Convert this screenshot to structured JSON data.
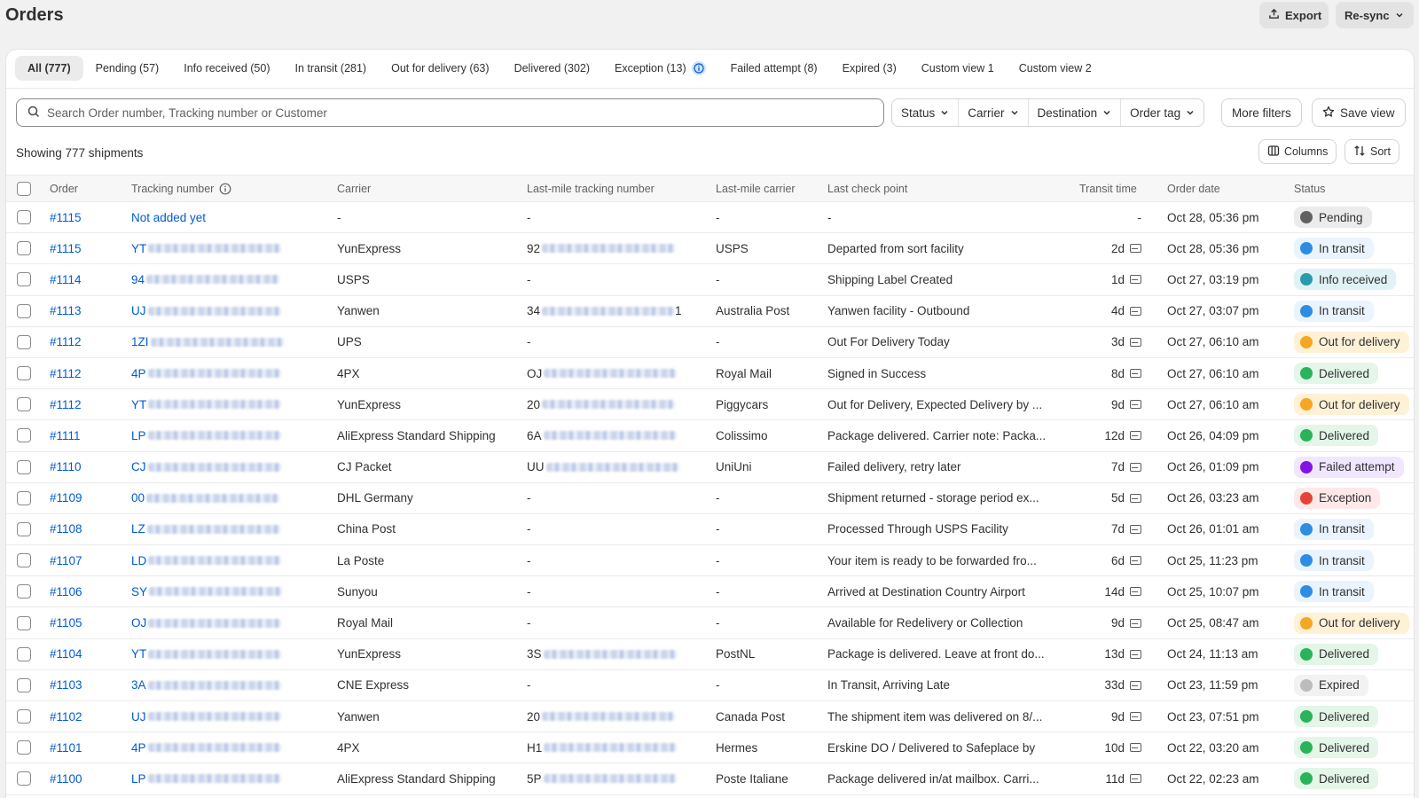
{
  "page": {
    "title": "Orders"
  },
  "actions": {
    "export": "Export",
    "resync": "Re-sync"
  },
  "tabs": [
    {
      "label": "All (777)",
      "active": true
    },
    {
      "label": "Pending (57)"
    },
    {
      "label": "Info received (50)"
    },
    {
      "label": "In transit (281)"
    },
    {
      "label": "Out for delivery (63)"
    },
    {
      "label": "Delivered (302)"
    },
    {
      "label": "Exception (13)",
      "info": true
    },
    {
      "label": "Failed attempt (8)"
    },
    {
      "label": "Expired (3)"
    },
    {
      "label": "Custom view 1"
    },
    {
      "label": "Custom view 2"
    }
  ],
  "search": {
    "placeholder": "Search Order number, Tracking number or Customer"
  },
  "filters": [
    "Status",
    "Carrier",
    "Destination",
    "Order tag"
  ],
  "more_filters": "More filters",
  "save_view": "Save view",
  "showing": "Showing 777 shipments",
  "columns_btn": "Columns",
  "sort_btn": "Sort",
  "columns": {
    "order": "Order",
    "tracking": "Tracking number",
    "carrier": "Carrier",
    "lm_tracking": "Last-mile tracking number",
    "lm_carrier": "Last-mile carrier",
    "checkpoint": "Last check point",
    "transit": "Transit time",
    "date": "Order date",
    "status": "Status"
  },
  "status_colors": {
    "Pending": {
      "bg": "#ebebeb",
      "dot": "#616161"
    },
    "In transit": {
      "bg": "#eaf4ff",
      "dot": "#2c8de3"
    },
    "Info received": {
      "bg": "#e0f2f5",
      "dot": "#2a9aae"
    },
    "Out for delivery": {
      "bg": "#fff1d6",
      "dot": "#f5a623"
    },
    "Delivered": {
      "bg": "#e3f6e8",
      "dot": "#29b35a"
    },
    "Failed attempt": {
      "bg": "#f1e6ff",
      "dot": "#8314e3"
    },
    "Exception": {
      "bg": "#fee9e8",
      "dot": "#e5433a"
    },
    "Expired": {
      "bg": "#f2f2f2",
      "dot": "#bcbcbc"
    }
  },
  "rows": [
    {
      "order": "#1115",
      "tracking": "Not added yet",
      "blur": false,
      "carrier": "-",
      "lm_tracking": "-",
      "lm_blur": false,
      "lm_carrier": "-",
      "checkpoint": "-",
      "transit": "-",
      "mail": false,
      "date": "Oct 28, 05:36 pm",
      "status": "Pending"
    },
    {
      "order": "#1115",
      "tracking": "YT",
      "blur": true,
      "carrier": "YunExpress",
      "lm_tracking": "92",
      "lm_blur": true,
      "lm_carrier": "USPS",
      "checkpoint": "Departed from sort facility",
      "transit": "2d",
      "mail": true,
      "date": "Oct 28, 05:36 pm",
      "status": "In transit"
    },
    {
      "order": "#1114",
      "tracking": "94",
      "blur": true,
      "carrier": "USPS",
      "lm_tracking": "-",
      "lm_blur": false,
      "lm_carrier": "-",
      "checkpoint": "Shipping Label Created",
      "transit": "1d",
      "mail": true,
      "date": "Oct 27, 03:19 pm",
      "status": "Info received"
    },
    {
      "order": "#1113",
      "tracking": "UJ",
      "blur": true,
      "carrier": "Yanwen",
      "lm_tracking": "34",
      "lm_blur": true,
      "lm_tail": "1",
      "lm_carrier": "Australia Post",
      "checkpoint": "Yanwen facility - Outbound",
      "transit": "4d",
      "mail": true,
      "date": "Oct 27, 03:07 pm",
      "status": "In transit"
    },
    {
      "order": "#1112",
      "tracking": "1ZI",
      "blur": true,
      "carrier": "UPS",
      "lm_tracking": "-",
      "lm_blur": false,
      "lm_carrier": "-",
      "checkpoint": "Out For Delivery Today",
      "transit": "3d",
      "mail": true,
      "date": "Oct 27, 06:10 am",
      "status": "Out for delivery"
    },
    {
      "order": "#1112",
      "tracking": "4P",
      "blur": true,
      "carrier": "4PX",
      "lm_tracking": "OJ",
      "lm_blur": true,
      "lm_carrier": "Royal Mail",
      "checkpoint": "Signed in Success",
      "transit": "8d",
      "mail": true,
      "date": "Oct 27, 06:10 am",
      "status": "Delivered"
    },
    {
      "order": "#1112",
      "tracking": "YT",
      "blur": true,
      "carrier": "YunExpress",
      "lm_tracking": "20",
      "lm_blur": true,
      "lm_carrier": "Piggycars",
      "checkpoint": "Out for Delivery, Expected Delivery by ...",
      "transit": "9d",
      "mail": true,
      "date": "Oct 27, 06:10 am",
      "status": "Out for delivery"
    },
    {
      "order": "#1111",
      "tracking": "LP",
      "blur": true,
      "carrier": "AliExpress Standard Shipping",
      "lm_tracking": "6A",
      "lm_blur": true,
      "lm_carrier": "Colissimo",
      "checkpoint": "Package delivered. Carrier note: Packa...",
      "transit": "12d",
      "mail": true,
      "date": "Oct 26, 04:09 pm",
      "status": "Delivered"
    },
    {
      "order": "#1110",
      "tracking": "CJ",
      "blur": true,
      "carrier": "CJ Packet",
      "lm_tracking": "UU",
      "lm_blur": true,
      "lm_carrier": "UniUni",
      "checkpoint": "Failed delivery, retry later",
      "transit": "7d",
      "mail": true,
      "date": "Oct 26, 01:09 pm",
      "status": "Failed attempt"
    },
    {
      "order": "#1109",
      "tracking": "00",
      "blur": true,
      "carrier": "DHL Germany",
      "lm_tracking": "-",
      "lm_blur": false,
      "lm_carrier": "-",
      "checkpoint": "Shipment returned - storage period ex...",
      "transit": "5d",
      "mail": true,
      "date": "Oct 26, 03:23 am",
      "status": "Exception"
    },
    {
      "order": "#1108",
      "tracking": "LZ",
      "blur": true,
      "carrier": "China Post",
      "lm_tracking": "-",
      "lm_blur": false,
      "lm_carrier": "-",
      "checkpoint": "Processed Through USPS Facility",
      "transit": "7d",
      "mail": true,
      "date": "Oct 26, 01:01 am",
      "status": "In transit"
    },
    {
      "order": "#1107",
      "tracking": "LD",
      "blur": true,
      "carrier": "La Poste",
      "lm_tracking": "-",
      "lm_blur": false,
      "lm_carrier": "-",
      "checkpoint": "Your item is ready to be forwarded fro...",
      "transit": "6d",
      "mail": true,
      "date": "Oct 25, 11:23 pm",
      "status": "In transit"
    },
    {
      "order": "#1106",
      "tracking": "SY",
      "blur": true,
      "carrier": "Sunyou",
      "lm_tracking": "-",
      "lm_blur": false,
      "lm_carrier": "-",
      "checkpoint": "Arrived at Destination Country Airport",
      "transit": "14d",
      "mail": true,
      "date": "Oct 25, 10:07 pm",
      "status": "In transit"
    },
    {
      "order": "#1105",
      "tracking": "OJ",
      "blur": true,
      "carrier": "Royal Mail",
      "lm_tracking": "-",
      "lm_blur": false,
      "lm_carrier": "-",
      "checkpoint": "Available for Redelivery or Collection",
      "transit": "9d",
      "mail": true,
      "date": "Oct 25, 08:47 am",
      "status": "Out for delivery"
    },
    {
      "order": "#1104",
      "tracking": "YT",
      "blur": true,
      "carrier": "YunExpress",
      "lm_tracking": "3S",
      "lm_blur": true,
      "lm_carrier": "PostNL",
      "checkpoint": "Package is delivered. Leave at front do...",
      "transit": "13d",
      "mail": true,
      "date": "Oct 24, 11:13 am",
      "status": "Delivered"
    },
    {
      "order": "#1103",
      "tracking": "3A",
      "blur": true,
      "carrier": "CNE Express",
      "lm_tracking": "-",
      "lm_blur": false,
      "lm_carrier": "-",
      "checkpoint": "In Transit, Arriving Late",
      "transit": "33d",
      "mail": true,
      "date": "Oct 23, 11:59 pm",
      "status": "Expired"
    },
    {
      "order": "#1102",
      "tracking": "UJ",
      "blur": true,
      "carrier": "Yanwen",
      "lm_tracking": "20",
      "lm_blur": true,
      "lm_carrier": "Canada Post",
      "checkpoint": "The shipment item was delivered on 8/...",
      "transit": "9d",
      "mail": true,
      "date": "Oct 23, 07:51 pm",
      "status": "Delivered"
    },
    {
      "order": "#1101",
      "tracking": "4P",
      "blur": true,
      "carrier": "4PX",
      "lm_tracking": "H1",
      "lm_blur": true,
      "lm_carrier": "Hermes",
      "checkpoint": "Erskine DO / Delivered to Safeplace by",
      "transit": "10d",
      "mail": true,
      "date": "Oct 22, 03:20 am",
      "status": "Delivered"
    },
    {
      "order": "#1100",
      "tracking": "LP",
      "blur": true,
      "carrier": "AliExpress Standard Shipping",
      "lm_tracking": "5P",
      "lm_blur": true,
      "lm_carrier": "Poste Italiane",
      "checkpoint": "Package delivered in/at mailbox. Carri...",
      "transit": "11d",
      "mail": true,
      "date": "Oct 22, 02:23 am",
      "status": "Delivered"
    }
  ]
}
